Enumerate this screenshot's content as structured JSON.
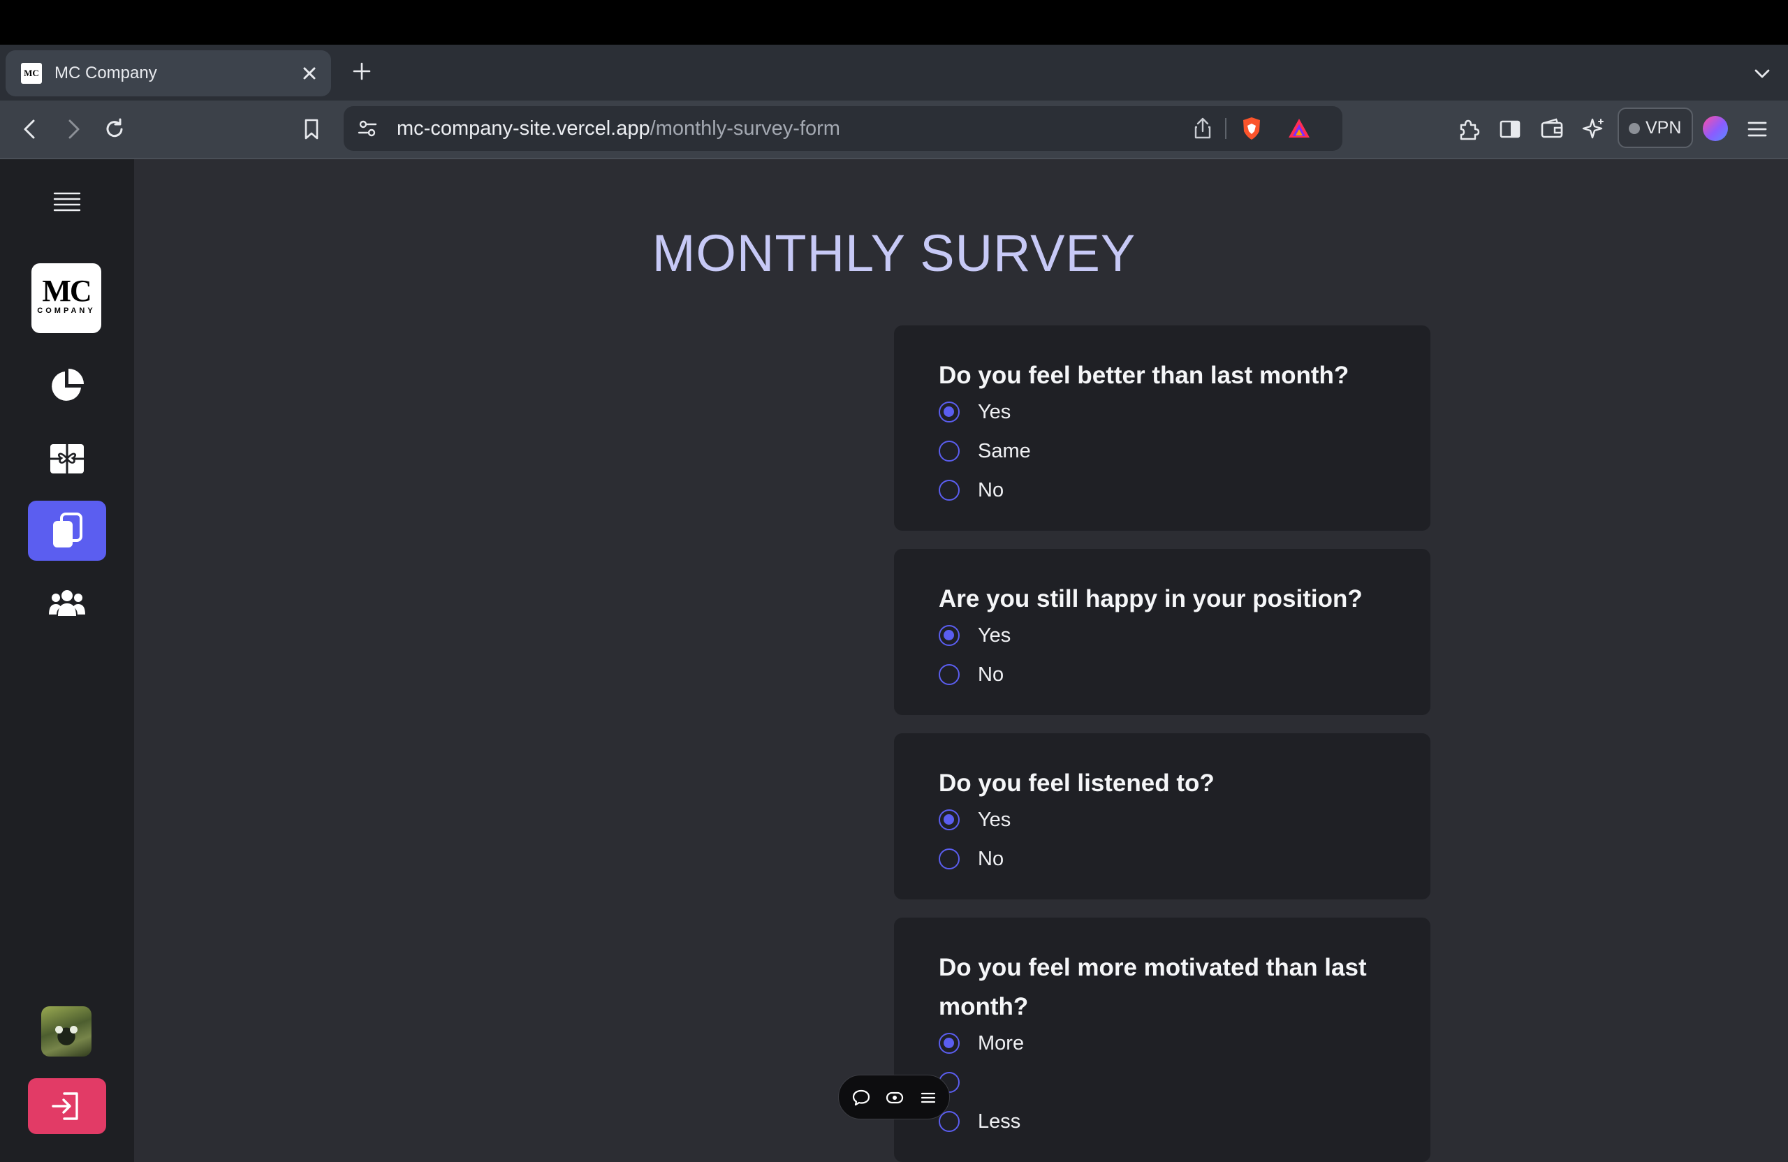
{
  "browser": {
    "tab": {
      "title": "MC Company",
      "favicon_text": "MC"
    },
    "url_host": "mc-company-site.vercel.app",
    "url_path": "/monthly-survey-form",
    "vpn_label": "VPN"
  },
  "sidebar": {
    "logo_main": "MC",
    "logo_sub": "COMPANY",
    "items": [
      {
        "name": "pie-chart-icon"
      },
      {
        "name": "gift-icon"
      },
      {
        "name": "clipboard-icon",
        "active": true
      },
      {
        "name": "users-icon"
      }
    ],
    "accent": "#5b5ef0",
    "logout_color": "#e23b66"
  },
  "page": {
    "title": "MONTHLY SURVEY",
    "questions": [
      {
        "text": "Do you feel better than last month?",
        "options": [
          "Yes",
          "Same",
          "No"
        ],
        "selected": "Yes"
      },
      {
        "text": "Are you still happy in your position?",
        "options": [
          "Yes",
          "No"
        ],
        "selected": "Yes"
      },
      {
        "text": "Do you feel listened to?",
        "options": [
          "Yes",
          "No"
        ],
        "selected": "Yes"
      },
      {
        "text": "Do you feel more motivated than last month?",
        "options": [
          "More",
          "",
          "Less"
        ],
        "selected": "More"
      }
    ]
  }
}
